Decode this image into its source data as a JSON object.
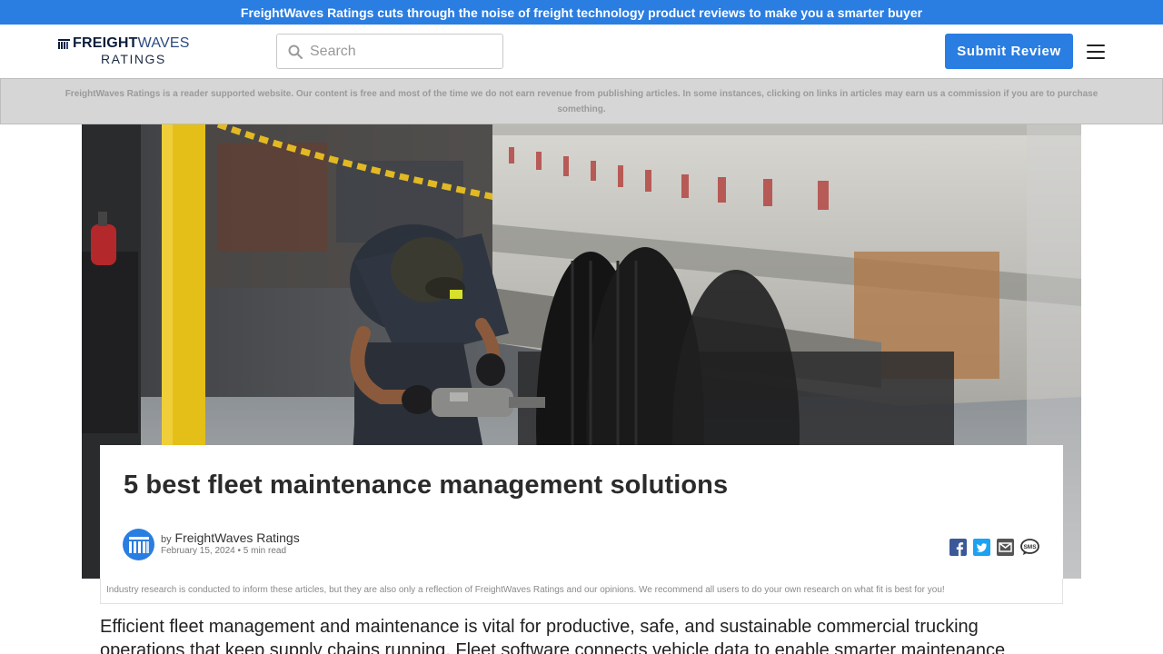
{
  "topbar": {
    "text": "FreightWaves Ratings cuts through the noise of freight technology product reviews to make you a smarter buyer"
  },
  "header": {
    "logo_top_bold": "FREIGHT",
    "logo_top_light": "WAVES",
    "logo_bottom": "RATINGS",
    "search_placeholder": "Search",
    "submit_label": "Submit Review"
  },
  "disclaimer": "FreightWaves Ratings is a reader supported website. Our content is free and most of the time we do not earn revenue from publishing articles. In some instances, clicking on links in articles may earn us a commission if you are to purchase something.",
  "article": {
    "title": "5 best fleet maintenance management solutions",
    "by": "by",
    "author": "FreightWaves Ratings",
    "meta": "February 15, 2024 • 5 min read",
    "research_note": "Industry research is conducted to inform these articles, but they are also only a reflection of FreightWaves Ratings and our opinions. We recommend all users to do your own research on what fit is best for you!",
    "intro": "Efficient fleet management and maintenance is vital for productive, safe, and sustainable commercial trucking operations that keep supply chains running. Fleet software connects vehicle data to enable smarter maintenance"
  },
  "share_icons": [
    "facebook-icon",
    "twitter-icon",
    "email-icon",
    "sms-icon"
  ],
  "colors": {
    "brand": "#2a7de1",
    "disclaimer_bg": "#d6d6d6"
  }
}
